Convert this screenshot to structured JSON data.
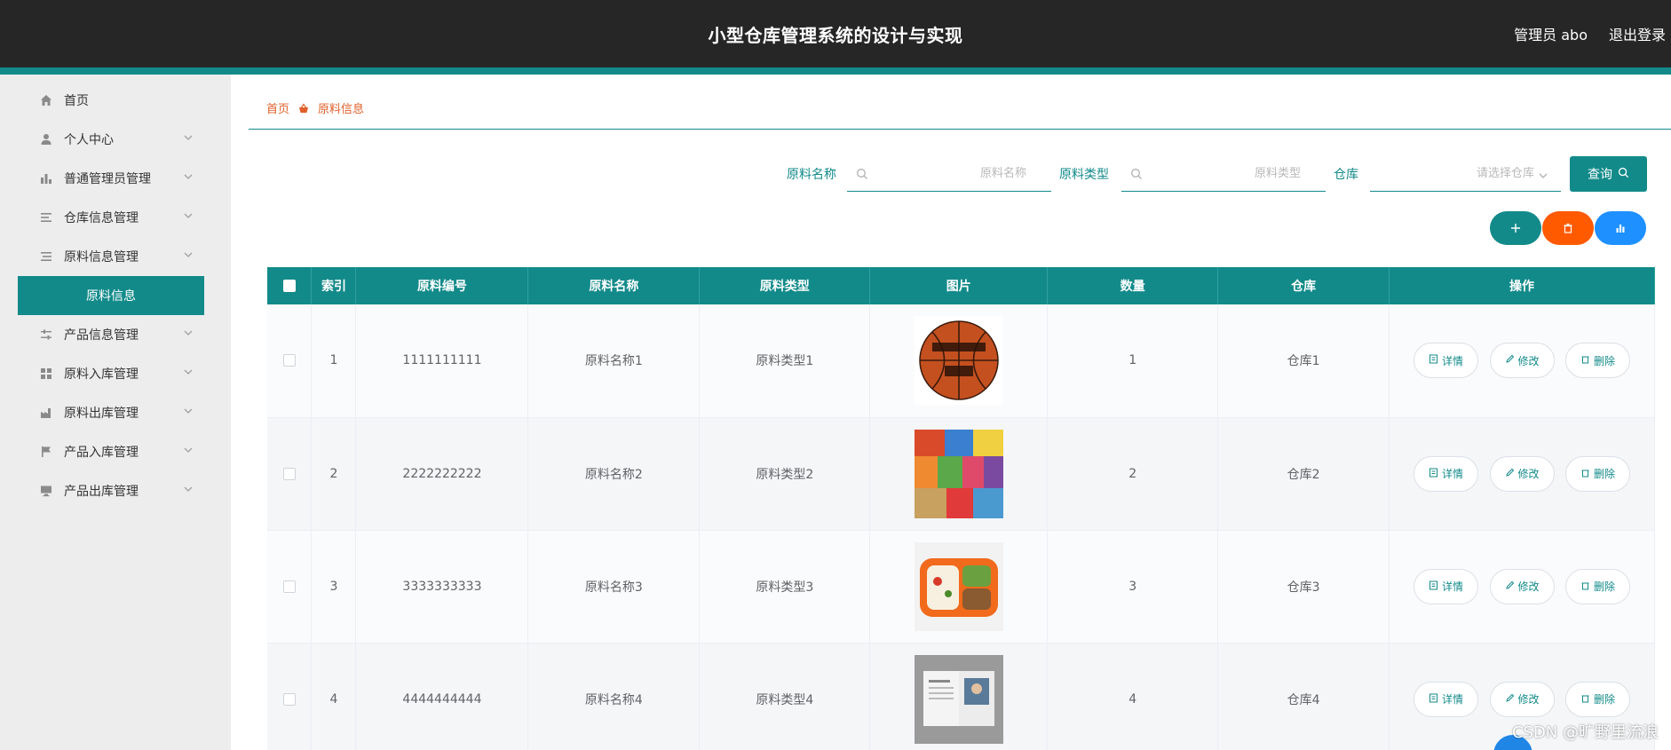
{
  "header": {
    "title": "小型仓库管理系统的设计与实现",
    "user": "管理员 abo",
    "logout": "退出登录"
  },
  "sidebar": {
    "items": [
      {
        "label": "首页",
        "icon": "home-icon"
      },
      {
        "label": "个人中心",
        "icon": "user-icon"
      },
      {
        "label": "普通管理员管理",
        "icon": "bar-chart-icon"
      },
      {
        "label": "仓库信息管理",
        "icon": "list-icon"
      },
      {
        "label": "原料信息管理",
        "icon": "list-icon"
      },
      {
        "label": "产品信息管理",
        "icon": "sliders-icon"
      },
      {
        "label": "原料入库管理",
        "icon": "grid-icon"
      },
      {
        "label": "原料出库管理",
        "icon": "factory-icon"
      },
      {
        "label": "产品入库管理",
        "icon": "flag-icon"
      },
      {
        "label": "产品出库管理",
        "icon": "monitor-icon"
      }
    ],
    "active_sub": "原料信息"
  },
  "breadcrumb": {
    "home": "首页",
    "current": "原料信息"
  },
  "search": {
    "name_label": "原料名称",
    "name_placeholder": "原料名称",
    "type_label": "原料类型",
    "type_placeholder": "原料类型",
    "warehouse_label": "仓库",
    "warehouse_placeholder": "请选择仓库",
    "query_button": "查询"
  },
  "colors": {
    "primary": "#138a8a",
    "danger": "#ff5a00",
    "info": "#1e90ff",
    "header": "#262626"
  },
  "table": {
    "headers": [
      "索引",
      "原料编号",
      "原料名称",
      "原料类型",
      "图片",
      "数量",
      "仓库",
      "操作"
    ],
    "rows": [
      {
        "index": "1",
        "code": "1111111111",
        "name": "原料名称1",
        "type": "原料类型1",
        "image": "basketball",
        "qty": "1",
        "warehouse": "仓库1"
      },
      {
        "index": "2",
        "code": "2222222222",
        "name": "原料名称2",
        "type": "原料类型2",
        "image": "snacks",
        "qty": "2",
        "warehouse": "仓库2"
      },
      {
        "index": "3",
        "code": "3333333333",
        "name": "原料名称3",
        "type": "原料类型3",
        "image": "lunchbox",
        "qty": "3",
        "warehouse": "仓库3"
      },
      {
        "index": "4",
        "code": "4444444444",
        "name": "原料名称4",
        "type": "原料类型4",
        "image": "magazine",
        "qty": "4",
        "warehouse": "仓库4"
      }
    ],
    "actions": {
      "detail": "详情",
      "edit": "修改",
      "delete": "删除"
    }
  },
  "watermark": "CSDN @旷野里流浪"
}
